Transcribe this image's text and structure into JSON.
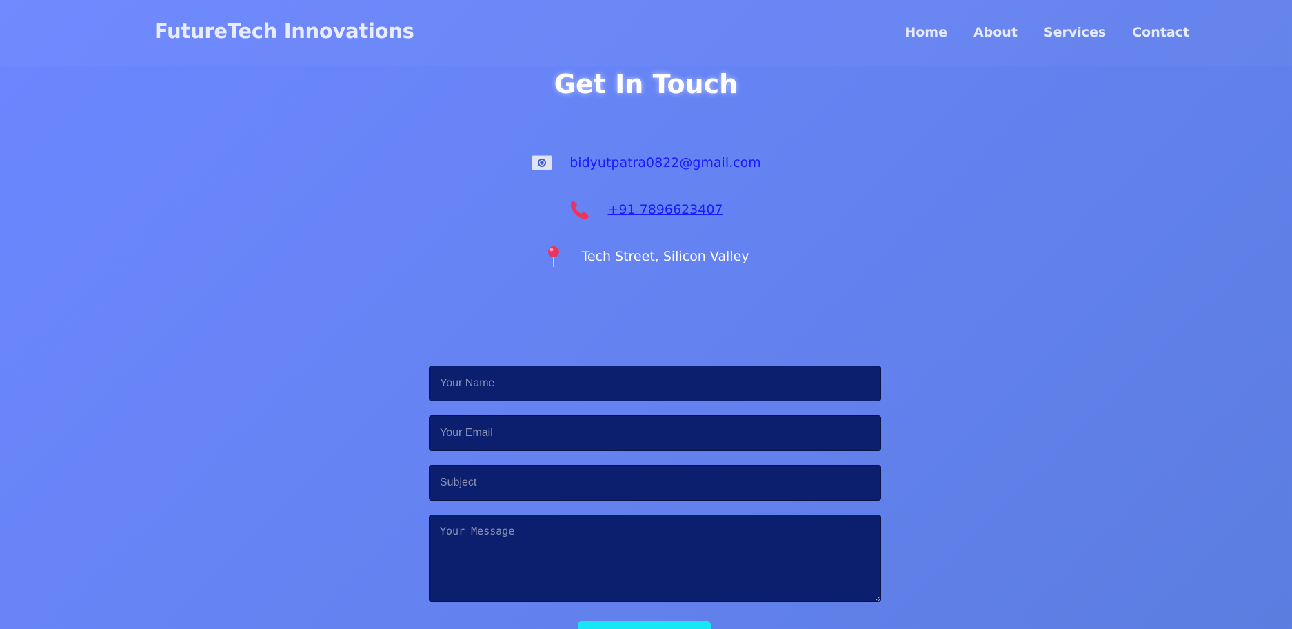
{
  "header": {
    "brand": "FutureTech Innovations",
    "nav": [
      {
        "label": "Home"
      },
      {
        "label": "About"
      },
      {
        "label": "Services"
      },
      {
        "label": "Contact"
      }
    ]
  },
  "page": {
    "title": "Get In Touch"
  },
  "contact": {
    "email": {
      "icon": "email-icon",
      "text": "bidyutpatra0822@gmail.com"
    },
    "phone": {
      "icon": "phone-icon",
      "text": "+91 7896623407"
    },
    "address": {
      "icon": "pin-icon",
      "text": "Tech Street, Silicon Valley"
    }
  },
  "form": {
    "name_placeholder": "Your Name",
    "email_placeholder": "Your Email",
    "subject_placeholder": "Subject",
    "message_placeholder": "Your Message",
    "submit_label": ""
  },
  "colors": {
    "background": "#6683f3",
    "field_background": "#0c1f6e",
    "link": "#1a1aff",
    "submit": "#18e6f5",
    "icon_accent": "#e8355f"
  }
}
